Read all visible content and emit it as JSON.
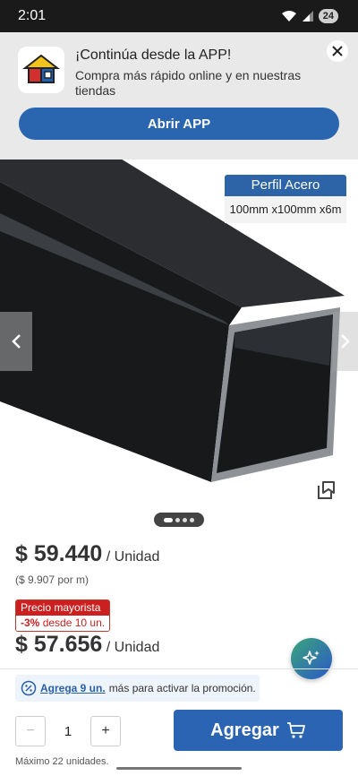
{
  "status_bar": {
    "time": "2:01",
    "battery": "24"
  },
  "app_banner": {
    "title": "¡Continúa desde la APP!",
    "subtitle": "Compra más rápido online y en nuestras tiendas",
    "open_button": "Abrir APP"
  },
  "product": {
    "tag_title": "Perfil Acero",
    "tag_dimensions": "100mm x100mm x6m"
  },
  "pricing": {
    "price": "$ 59.440",
    "unit": "/ Unidad",
    "price_per_m": "($ 9.907 por m)",
    "wholesale_label": "Precio mayorista",
    "wholesale_discount": "-3%",
    "wholesale_from": "desde 10 un.",
    "wholesale_price": "$ 57.656",
    "wholesale_unit": "/ Unidad"
  },
  "promo": {
    "link": "Agrega 9 un.",
    "text": "más para activar la promoción."
  },
  "cart": {
    "quantity": "1",
    "add_label": "Agregar",
    "max_units": "Máximo 22 unidades."
  },
  "colors": {
    "primary": "#2c64b4",
    "sale": "#cc1f1f"
  }
}
